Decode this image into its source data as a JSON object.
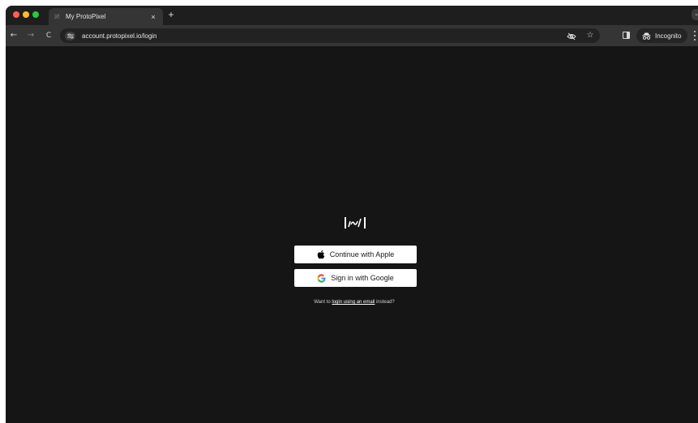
{
  "browser": {
    "tab": {
      "favicon_text": "|//|",
      "title": "My ProtoPixel",
      "close_glyph": "×"
    },
    "new_tab_glyph": "+",
    "tab_search_glyph": "⌄",
    "nav": {
      "back_glyph": "←",
      "forward_glyph": "→",
      "reload_glyph": "C"
    },
    "address_bar": {
      "url": "account.protopixel.io/login"
    },
    "bookmark_glyph": "☆",
    "incognito_label": "Incognito"
  },
  "login": {
    "apple_button_label": "Continue with Apple",
    "google_button_label": "Sign in with Google",
    "email_hint_prefix": "Want to ",
    "email_hint_link": "login using an email",
    "email_hint_suffix": " instead?"
  },
  "colors": {
    "page_background": "#151515",
    "tabstrip": "#1e1e1e",
    "toolbar": "#353535",
    "button_background": "#ffffff",
    "google_blue": "#4285F4",
    "google_red": "#EA4335",
    "google_yellow": "#FBBC05",
    "google_green": "#34A853"
  },
  "icons": {
    "traffic_lights": [
      "close-dot",
      "minimize-dot",
      "maximize-dot"
    ],
    "address_bar": [
      "site-info-icon",
      "eye-off-icon",
      "bookmark-star-icon"
    ],
    "toolbar": [
      "side-panel-icon",
      "incognito-icon",
      "kebab-menu-icon"
    ],
    "buttons": [
      "apple-icon",
      "google-icon"
    ],
    "brand": "protopixel-logo"
  }
}
